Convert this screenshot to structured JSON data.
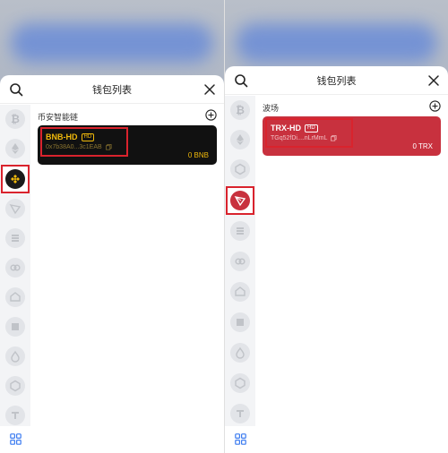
{
  "colors": {
    "accent": "#d9232d",
    "bnb_gold": "#f0b90b",
    "tron_red": "#c8313e",
    "card_dark": "#111111",
    "link_blue": "#3b7bf0"
  },
  "left": {
    "header": {
      "title": "钱包列表"
    },
    "section_label": "币安智能链",
    "wallet": {
      "name": "BNB-HD",
      "badge": "HD",
      "address": "0x7b38A0...3c1EAB",
      "balance": "0 BNB"
    },
    "rail_icons": [
      "bitcoin-icon",
      "ethereum-icon",
      "bnb-icon",
      "tron-icon",
      "solana-icon",
      "polkadot-icon",
      "avalanche-icon",
      "square-chain-icon",
      "drop-chain-icon",
      "cube-chain-icon",
      "tezos-icon"
    ],
    "selected_icon": "bnb-icon"
  },
  "right": {
    "header": {
      "title": "钱包列表"
    },
    "section_label": "波场",
    "wallet": {
      "name": "TRX-HD",
      "badge": "HD",
      "address": "TGq52fDi....nLrMmL",
      "balance": "0 TRX"
    },
    "rail_icons": [
      "bitcoin-icon",
      "ethereum-icon",
      "cube-chain-icon",
      "tron-icon",
      "solana-icon",
      "polkadot-icon",
      "avalanche-icon",
      "square-chain-icon",
      "drop-chain-icon",
      "cube-chain-icon",
      "tezos-icon"
    ],
    "selected_icon": "tron-icon"
  }
}
